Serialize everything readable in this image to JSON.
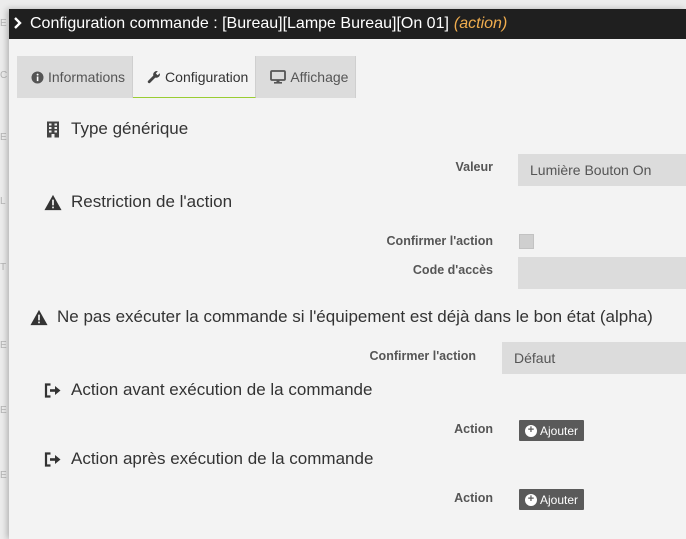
{
  "modal": {
    "title": "Configuration commande : [Bureau][Lampe Bureau][On 01]",
    "title_kind": "(action)"
  },
  "tabs": [
    {
      "label": "Informations",
      "icon": "info-circle-icon"
    },
    {
      "label": "Configuration",
      "icon": "wrench-icon",
      "active": true
    },
    {
      "label": "Affichage",
      "icon": "monitor-icon"
    }
  ],
  "sections": {
    "generic_type": {
      "title": "Type générique",
      "icon": "building-icon",
      "value_label": "Valeur",
      "value": "Lumière Bouton On"
    },
    "restriction": {
      "title": "Restriction de l'action",
      "icon": "warning-icon",
      "confirm_label": "Confirmer l'action",
      "confirm_checked": false,
      "code_label": "Code d'accès",
      "code_value": ""
    },
    "no_repeat": {
      "title": "Ne pas exécuter la commande si l'équipement est déjà dans le bon état (alpha)",
      "icon": "warning-icon",
      "confirm_label": "Confirmer l'action",
      "select_value": "Défaut"
    },
    "before": {
      "title": "Action avant exécution de la commande",
      "icon": "sign-out-icon",
      "action_label": "Action",
      "button_label": "Ajouter"
    },
    "after": {
      "title": "Action après exécution de la commande",
      "icon": "sign-out-icon",
      "action_label": "Action",
      "button_label": "Ajouter"
    }
  },
  "colors": {
    "titlebar_bg": "#1f1f1f",
    "accent_kind": "#f0ad4e",
    "active_tab_underline": "#9acd32",
    "button_bg": "#5a5a5a"
  }
}
